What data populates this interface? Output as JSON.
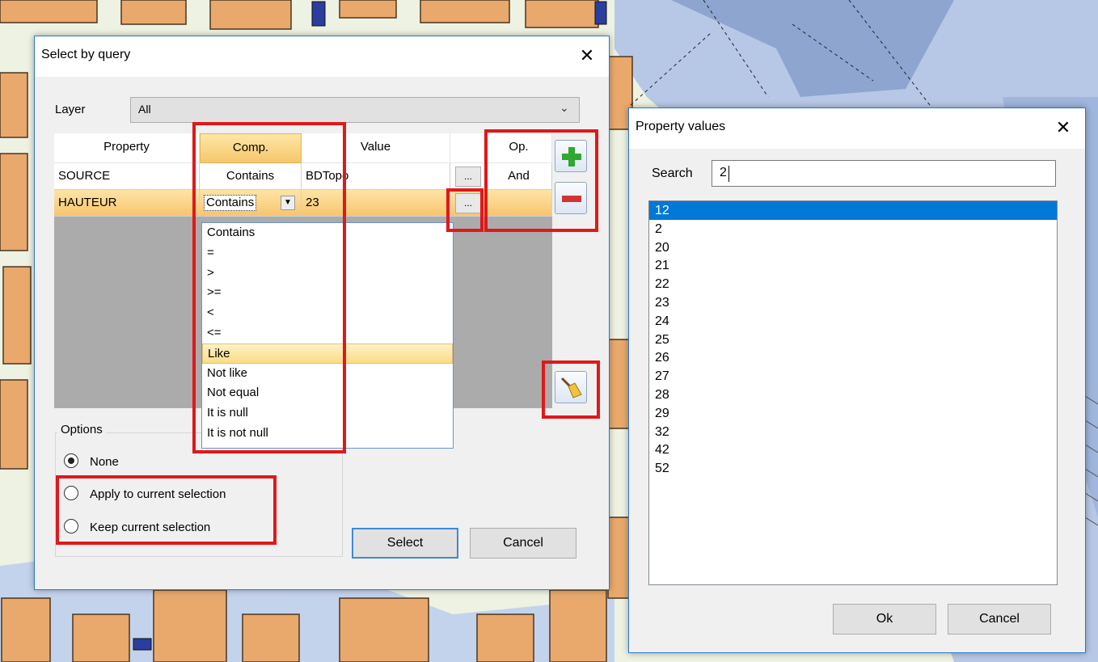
{
  "select_dialog": {
    "title": "Select by query",
    "layer_label": "Layer",
    "layer_value": "All",
    "columns": [
      "Property",
      "Comp.",
      "Value",
      "",
      "Op."
    ],
    "rows": [
      {
        "property": "SOURCE",
        "comp": "Contains",
        "value": "BDTopo",
        "op": "And"
      },
      {
        "property": "HAUTEUR",
        "comp": "Contains",
        "value": "23",
        "op": ""
      }
    ],
    "ellipsis": "...",
    "comparison_options": [
      "Contains",
      "=",
      ">",
      ">=",
      "<",
      "<=",
      "Like",
      "Not like",
      "Not equal",
      "It is null",
      "It is not null"
    ],
    "highlighted_option": "Like",
    "options_label": "Options",
    "radio_options": [
      "None",
      "Apply to current selection",
      "Keep current selection"
    ],
    "selected_radio": "None",
    "select_button": "Select",
    "cancel_button": "Cancel"
  },
  "property_values_dialog": {
    "title": "Property values",
    "search_label": "Search",
    "search_value": "2",
    "values": [
      "12",
      "2",
      "20",
      "21",
      "22",
      "23",
      "24",
      "25",
      "26",
      "27",
      "28",
      "29",
      "32",
      "42",
      "52"
    ],
    "selected_value": "12",
    "ok_button": "Ok",
    "cancel_button": "Cancel"
  },
  "colors": {
    "accent": "#0078d7",
    "highlight_row": "#f6c56e",
    "annotation_red": "#e0181a",
    "map_water": "#b7c8e6",
    "map_building": "#e9a96c",
    "map_ground": "#eef2e2"
  }
}
